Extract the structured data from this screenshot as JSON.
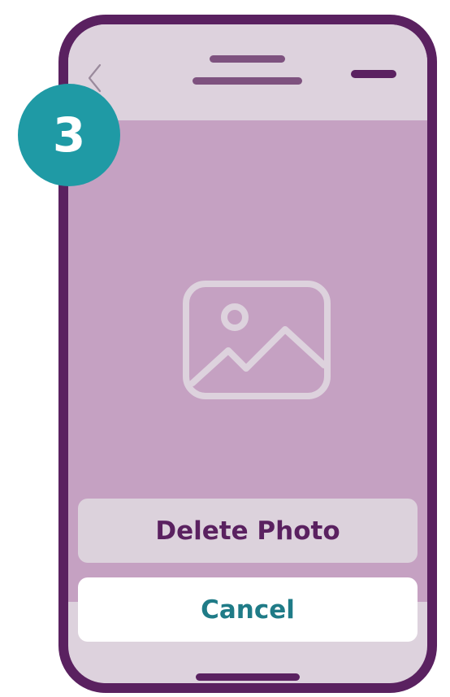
{
  "step": {
    "number": "3"
  },
  "header": {
    "back_icon": "chevron-left-icon"
  },
  "photo": {
    "icon": "image-placeholder-icon"
  },
  "actions": {
    "delete_label": "Delete Photo",
    "cancel_label": "Cancel"
  },
  "colors": {
    "phone_frame": "#5a2160",
    "header_bg": "#ddd2dd",
    "content_bg": "#c5a1c2",
    "badge_bg": "#1f9aa5",
    "delete_text": "#5a2160",
    "cancel_text": "#1f7b87"
  }
}
